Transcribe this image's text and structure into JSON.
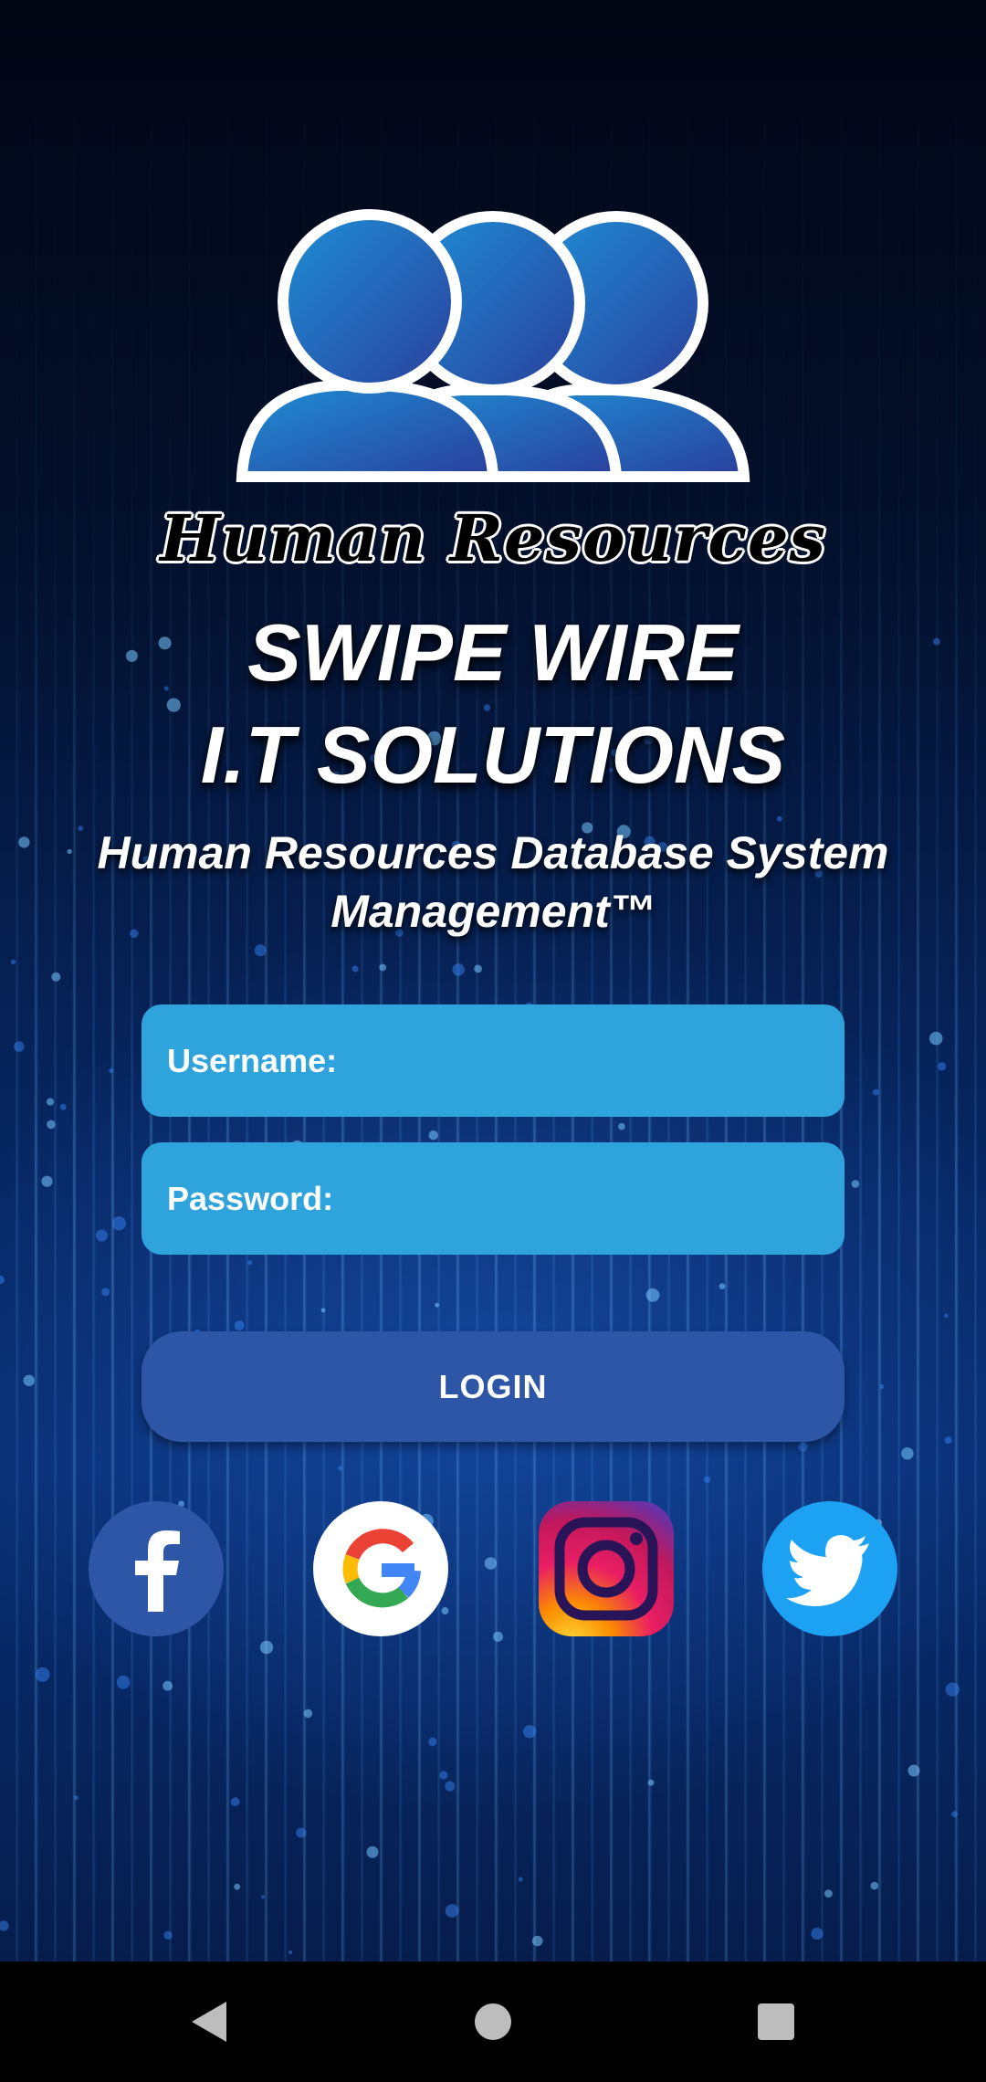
{
  "app": {
    "logo_text": "Human Resources",
    "title_line1": "SWIPE WIRE",
    "title_line2": "I.T SOLUTIONS",
    "subtitle": "Human Resources Database System Management™"
  },
  "form": {
    "username_label": "Username:",
    "username_value": "",
    "password_label": "Password:",
    "password_value": "",
    "login_label": "LOGIN"
  },
  "social": [
    {
      "name": "facebook-icon",
      "color": "#2e56a6"
    },
    {
      "name": "google-icon",
      "color": "#ffffff"
    },
    {
      "name": "instagram-icon",
      "color": "#c13584"
    },
    {
      "name": "twitter-icon",
      "color": "#1da1f2"
    }
  ],
  "colors": {
    "field_bg": "#2fa3dc",
    "button_bg": "#2e56a6",
    "text": "#ffffff"
  },
  "navbar": {
    "items": [
      "back-icon",
      "home-icon",
      "recents-icon"
    ]
  }
}
